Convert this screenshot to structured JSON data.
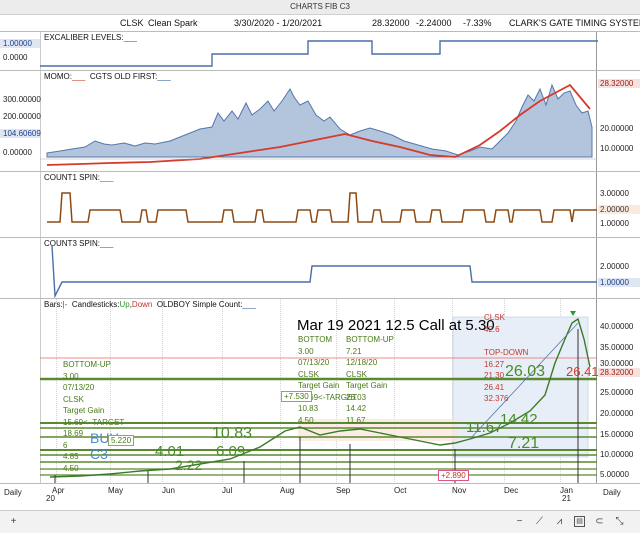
{
  "window": {
    "title": "CHARTS FIB C3"
  },
  "info": {
    "symbol": "CLSK",
    "name": "Clean Spark",
    "date_range": "3/30/2020 - 1/20/2021",
    "price": "28.32000",
    "change": "-2.24000",
    "change_pct": "-7.33%",
    "system": "CLARK'S GATE TIMING SYSTEM"
  },
  "panels": {
    "excaliber": {
      "label": "EXCALIBER LEVELS:",
      "left_ticks": [
        "1.00000",
        "0.0000"
      ]
    },
    "momo": {
      "label_a": "MOMO:",
      "label_b": "CGTS OLD FIRST:",
      "left_ticks": [
        "300.00000",
        "200.00000",
        "104.60609",
        "0.00000"
      ],
      "right_ticks": [
        "28.32000",
        "20.00000",
        "10.00000"
      ]
    },
    "count1": {
      "label": "COUNT1 SPIN:",
      "right_ticks": [
        "3.00000",
        "2.00000",
        "1.00000"
      ]
    },
    "count3": {
      "label": "COUNT3 SPIN:",
      "right_ticks": [
        "2.00000",
        "1.00000"
      ]
    },
    "price": {
      "label_bars": "Bars:",
      "label_candles": "Candlesticks:",
      "label_up": "Up",
      "label_down": "Down",
      "label_oldboy": "OLDBOY Simple Count:",
      "right_ticks": [
        "40.00000",
        "35.00000",
        "30.00000",
        "28.32000",
        "25.00000",
        "20.00000",
        "15.00000",
        "10.00000",
        "5.00000"
      ]
    }
  },
  "annotations": {
    "headline": "Mar 19 2021 12.5 Call at 5.30",
    "bottom_up_left": [
      "BOTTOM-UP",
      "3.00",
      "07/13/20",
      "CLSK",
      "Target Gain",
      "15.69<- TARGET",
      "18.69",
      "6",
      "4.85",
      "4.50"
    ],
    "bottom_mid": [
      "BOTTOM",
      "3.00",
      "07/13/20",
      "CLSK",
      "Target Gain",
      "13.69<-TARGET",
      "10.83",
      "4.50"
    ],
    "bottom_up_mid": [
      "BOTTOM-UP",
      "7.21",
      "12/18/20",
      "CLSK",
      "Target Gain",
      "26.03",
      "14.42",
      "11.67"
    ],
    "top_down": [
      "CLSK",
      "42.6",
      "TOP-DOWN",
      "16.27",
      "21.30",
      "26.41",
      "32.376"
    ],
    "big_labels": {
      "buy": "BUY",
      "c3": "C3",
      "n401": "4.01",
      "n222": "2.22",
      "n1083": "10.83",
      "n609": "6.09",
      "n2603": "26.03",
      "n2641": "26.41",
      "n1167": "11.67",
      "n1442": "14.42",
      "n721": "7.21"
    },
    "small_labels": {
      "p7530": "+7.530",
      "p2890": "+2.890",
      "p220": "5.220"
    }
  },
  "x_axis": {
    "mode": "Daily",
    "months": [
      "Apr",
      "May",
      "Jun",
      "Jul",
      "Aug",
      "Sep",
      "Oct",
      "Nov",
      "Dec",
      "Jan"
    ],
    "year_start": "20",
    "year_end": "21"
  }
}
